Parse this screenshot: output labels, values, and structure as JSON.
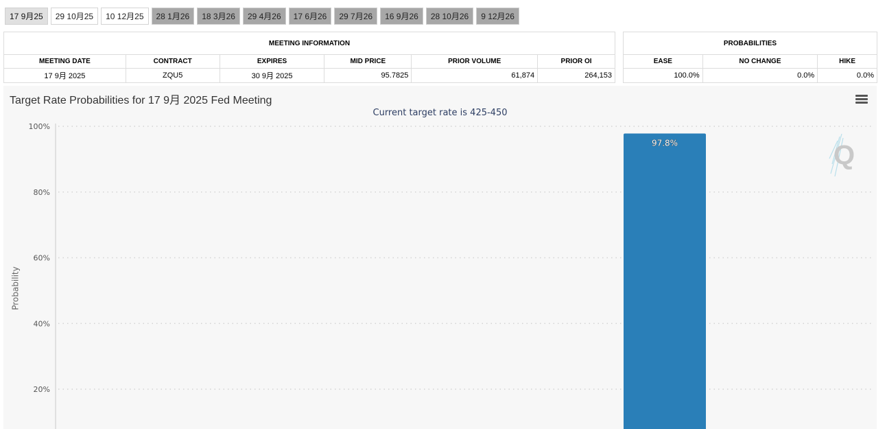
{
  "tabs": [
    {
      "label": "17 9月25",
      "state": "active"
    },
    {
      "label": "29 10月25",
      "state": "white"
    },
    {
      "label": "10 12月25",
      "state": "white"
    },
    {
      "label": "28 1月26",
      "state": "gray"
    },
    {
      "label": "18 3月26",
      "state": "gray"
    },
    {
      "label": "29 4月26",
      "state": "gray"
    },
    {
      "label": "17 6月26",
      "state": "gray"
    },
    {
      "label": "29 7月26",
      "state": "gray"
    },
    {
      "label": "16 9月26",
      "state": "gray"
    },
    {
      "label": "28 10月26",
      "state": "gray"
    },
    {
      "label": "9 12月26",
      "state": "gray"
    }
  ],
  "meeting_info": {
    "title": "MEETING INFORMATION",
    "headers": [
      "MEETING DATE",
      "CONTRACT",
      "EXPIRES",
      "MID PRICE",
      "PRIOR VOLUME",
      "PRIOR OI"
    ],
    "row": [
      "17 9月 2025",
      "ZQU5",
      "30 9月 2025",
      "95.7825",
      "61,874",
      "264,153"
    ]
  },
  "probabilities": {
    "title": "PROBABILITIES",
    "headers": [
      "EASE",
      "NO CHANGE",
      "HIKE"
    ],
    "row": [
      "100.0%",
      "0.0%",
      "0.0%"
    ]
  },
  "chart": {
    "title": "Target Rate Probabilities for 17 9月 2025 Fed Meeting",
    "subtitle": "Current target rate is 425-450",
    "menu_icon": "hamburger-menu-icon",
    "watermark_icon": "q-logo-icon",
    "bar_color": "#2a7fb8"
  },
  "chart_data": {
    "type": "bar",
    "title": "Target Rate Probabilities for 17 9月 2025 Fed Meeting",
    "subtitle": "Current target rate is 425-450",
    "ylabel": "Probability",
    "xlabel": "",
    "ylim": [
      0,
      100
    ],
    "yticks": [
      "20%",
      "40%",
      "60%",
      "80%",
      "100%"
    ],
    "grid": true,
    "values": [
      97.8
    ],
    "data_labels": [
      "97.8%"
    ]
  }
}
